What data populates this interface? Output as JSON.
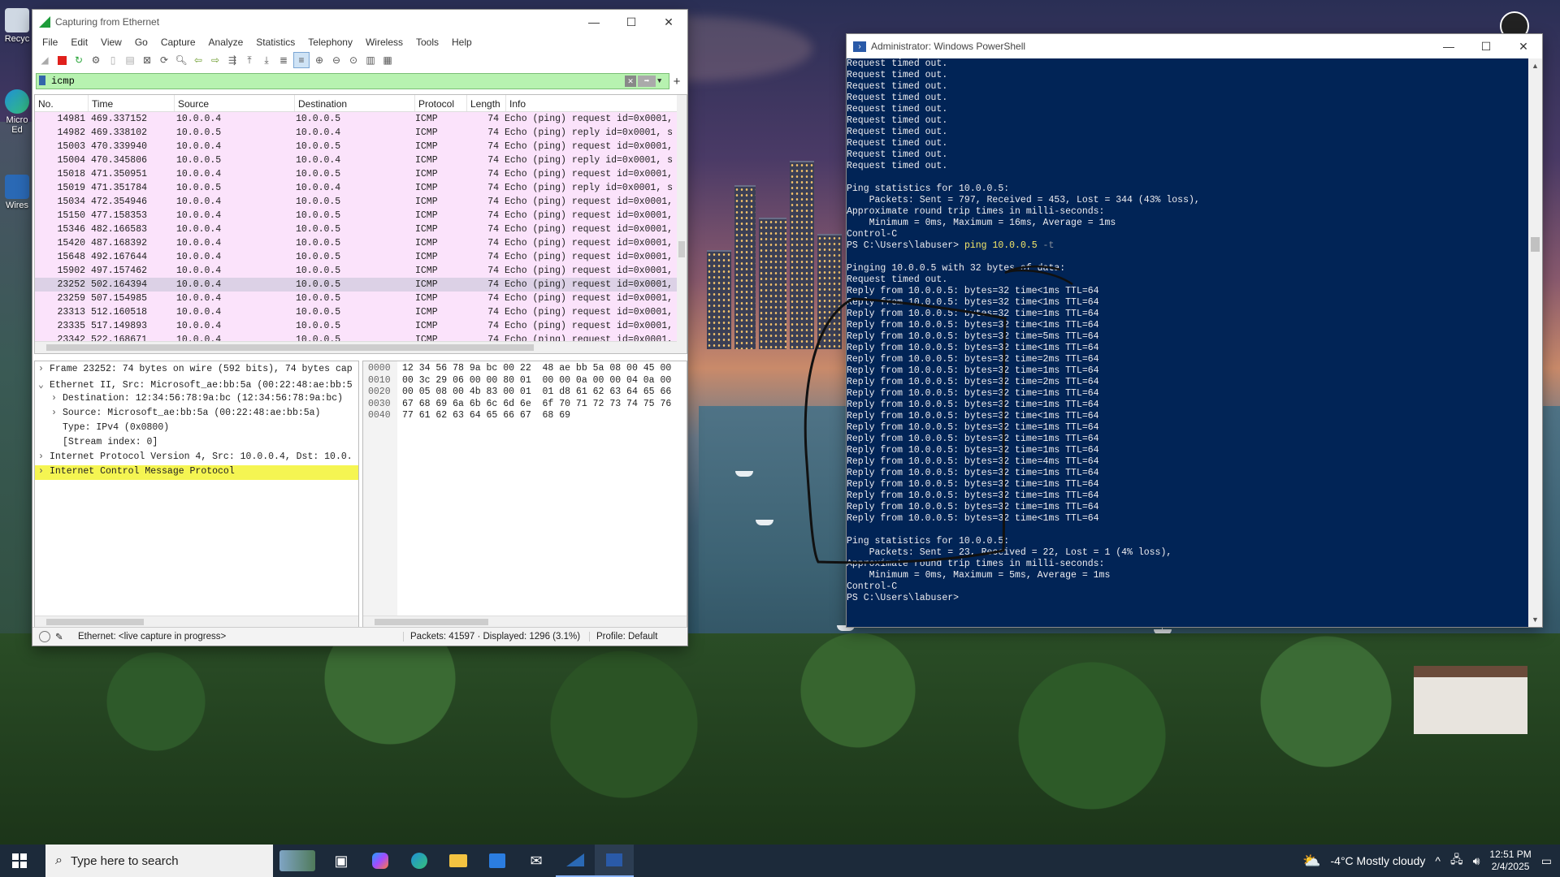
{
  "desktop": {
    "icons": [
      {
        "label": "Recyc"
      },
      {
        "label": "Micro Ed"
      },
      {
        "label": "Wires"
      }
    ]
  },
  "wireshark": {
    "title": "Capturing from Ethernet",
    "menu": [
      "File",
      "Edit",
      "View",
      "Go",
      "Capture",
      "Analyze",
      "Statistics",
      "Telephony",
      "Wireless",
      "Tools",
      "Help"
    ],
    "filter": "icmp",
    "columns": [
      "No.",
      "Time",
      "Source",
      "Destination",
      "Protocol",
      "Length",
      "Info"
    ],
    "packets": [
      {
        "no": "14981",
        "time": "469.337152",
        "src": "10.0.0.4",
        "dst": "10.0.0.5",
        "proto": "ICMP",
        "len": "74",
        "info": "Echo (ping) request  id=0x0001, s"
      },
      {
        "no": "14982",
        "time": "469.338102",
        "src": "10.0.0.5",
        "dst": "10.0.0.4",
        "proto": "ICMP",
        "len": "74",
        "info": "Echo (ping) reply    id=0x0001, s"
      },
      {
        "no": "15003",
        "time": "470.339940",
        "src": "10.0.0.4",
        "dst": "10.0.0.5",
        "proto": "ICMP",
        "len": "74",
        "info": "Echo (ping) request  id=0x0001, s"
      },
      {
        "no": "15004",
        "time": "470.345806",
        "src": "10.0.0.5",
        "dst": "10.0.0.4",
        "proto": "ICMP",
        "len": "74",
        "info": "Echo (ping) reply    id=0x0001, s"
      },
      {
        "no": "15018",
        "time": "471.350951",
        "src": "10.0.0.4",
        "dst": "10.0.0.5",
        "proto": "ICMP",
        "len": "74",
        "info": "Echo (ping) request  id=0x0001, s"
      },
      {
        "no": "15019",
        "time": "471.351784",
        "src": "10.0.0.5",
        "dst": "10.0.0.4",
        "proto": "ICMP",
        "len": "74",
        "info": "Echo (ping) reply    id=0x0001, s"
      },
      {
        "no": "15034",
        "time": "472.354946",
        "src": "10.0.0.4",
        "dst": "10.0.0.5",
        "proto": "ICMP",
        "len": "74",
        "info": "Echo (ping) request  id=0x0001, s"
      },
      {
        "no": "15150",
        "time": "477.158353",
        "src": "10.0.0.4",
        "dst": "10.0.0.5",
        "proto": "ICMP",
        "len": "74",
        "info": "Echo (ping) request  id=0x0001, s"
      },
      {
        "no": "15346",
        "time": "482.166583",
        "src": "10.0.0.4",
        "dst": "10.0.0.5",
        "proto": "ICMP",
        "len": "74",
        "info": "Echo (ping) request  id=0x0001, s"
      },
      {
        "no": "15420",
        "time": "487.168392",
        "src": "10.0.0.4",
        "dst": "10.0.0.5",
        "proto": "ICMP",
        "len": "74",
        "info": "Echo (ping) request  id=0x0001, s"
      },
      {
        "no": "15648",
        "time": "492.167644",
        "src": "10.0.0.4",
        "dst": "10.0.0.5",
        "proto": "ICMP",
        "len": "74",
        "info": "Echo (ping) request  id=0x0001, s"
      },
      {
        "no": "15902",
        "time": "497.157462",
        "src": "10.0.0.4",
        "dst": "10.0.0.5",
        "proto": "ICMP",
        "len": "74",
        "info": "Echo (ping) request  id=0x0001, s"
      },
      {
        "no": "23252",
        "time": "502.164394",
        "src": "10.0.0.4",
        "dst": "10.0.0.5",
        "proto": "ICMP",
        "len": "74",
        "info": "Echo (ping) request  id=0x0001, s",
        "selected": true
      },
      {
        "no": "23259",
        "time": "507.154985",
        "src": "10.0.0.4",
        "dst": "10.0.0.5",
        "proto": "ICMP",
        "len": "74",
        "info": "Echo (ping) request  id=0x0001, s"
      },
      {
        "no": "23313",
        "time": "512.160518",
        "src": "10.0.0.4",
        "dst": "10.0.0.5",
        "proto": "ICMP",
        "len": "74",
        "info": "Echo (ping) request  id=0x0001, s"
      },
      {
        "no": "23335",
        "time": "517.149893",
        "src": "10.0.0.4",
        "dst": "10.0.0.5",
        "proto": "ICMP",
        "len": "74",
        "info": "Echo (ping) request  id=0x0001, s"
      },
      {
        "no": "23342",
        "time": "522.168671",
        "src": "10.0.0.4",
        "dst": "10.0.0.5",
        "proto": "ICMP",
        "len": "74",
        "info": "Echo (ping) request  id=0x0001, s"
      }
    ],
    "details": [
      {
        "arrow": ">",
        "text": "Frame 23252: 74 bytes on wire (592 bits), 74 bytes cap",
        "indent": 0
      },
      {
        "arrow": "v",
        "text": "Ethernet II, Src: Microsoft_ae:bb:5a (00:22:48:ae:bb:5",
        "indent": 0
      },
      {
        "arrow": ">",
        "text": "Destination: 12:34:56:78:9a:bc (12:34:56:78:9a:bc)",
        "indent": 1
      },
      {
        "arrow": ">",
        "text": "Source: Microsoft_ae:bb:5a (00:22:48:ae:bb:5a)",
        "indent": 1
      },
      {
        "arrow": "",
        "text": "Type: IPv4 (0x0800)",
        "indent": 1
      },
      {
        "arrow": "",
        "text": "[Stream index: 0]",
        "indent": 1
      },
      {
        "arrow": ">",
        "text": "Internet Protocol Version 4, Src: 10.0.0.4, Dst: 10.0.",
        "indent": 0
      },
      {
        "arrow": ">",
        "text": "Internet Control Message Protocol",
        "indent": 0,
        "highlight": true
      }
    ],
    "bytes": [
      {
        "off": "0000",
        "hex": "12 34 56 78 9a bc 00 22  48 ae bb 5a 08 00 45 00"
      },
      {
        "off": "0010",
        "hex": "00 3c 29 06 00 00 80 01  00 00 0a 00 00 04 0a 00"
      },
      {
        "off": "0020",
        "hex": "00 05 08 00 4b 83 00 01  01 d8 61 62 63 64 65 66"
      },
      {
        "off": "0030",
        "hex": "67 68 69 6a 6b 6c 6d 6e  6f 70 71 72 73 74 75 76"
      },
      {
        "off": "0040",
        "hex": "77 61 62 63 64 65 66 67  68 69"
      }
    ],
    "status": {
      "interface": "Ethernet: <live capture in progress>",
      "packets": "Packets: 41597 · Displayed: 1296 (3.1%)",
      "profile": "Profile: Default"
    }
  },
  "powershell": {
    "title": "Administrator: Windows PowerShell",
    "lines": [
      "Request timed out.",
      "Request timed out.",
      "Request timed out.",
      "Request timed out.",
      "Request timed out.",
      "Request timed out.",
      "Request timed out.",
      "Request timed out.",
      "Request timed out.",
      "Request timed out.",
      "",
      "Ping statistics for 10.0.0.5:",
      "    Packets: Sent = 797, Received = 453, Lost = 344 (43% loss),",
      "Approximate round trip times in milli-seconds:",
      "    Minimum = 0ms, Maximum = 16ms, Average = 1ms",
      "Control-C",
      "PS C:\\Users\\labuser> ping 10.0.0.5 -t",
      "",
      "Pinging 10.0.0.5 with 32 bytes of data:",
      "Request timed out.",
      "Reply from 10.0.0.5: bytes=32 time<1ms TTL=64",
      "Reply from 10.0.0.5: bytes=32 time<1ms TTL=64",
      "Reply from 10.0.0.5: bytes=32 time=1ms TTL=64",
      "Reply from 10.0.0.5: bytes=32 time<1ms TTL=64",
      "Reply from 10.0.0.5: bytes=32 time=5ms TTL=64",
      "Reply from 10.0.0.5: bytes=32 time<1ms TTL=64",
      "Reply from 10.0.0.5: bytes=32 time=2ms TTL=64",
      "Reply from 10.0.0.5: bytes=32 time=1ms TTL=64",
      "Reply from 10.0.0.5: bytes=32 time=2ms TTL=64",
      "Reply from 10.0.0.5: bytes=32 time=1ms TTL=64",
      "Reply from 10.0.0.5: bytes=32 time=1ms TTL=64",
      "Reply from 10.0.0.5: bytes=32 time<1ms TTL=64",
      "Reply from 10.0.0.5: bytes=32 time=1ms TTL=64",
      "Reply from 10.0.0.5: bytes=32 time=1ms TTL=64",
      "Reply from 10.0.0.5: bytes=32 time=1ms TTL=64",
      "Reply from 10.0.0.5: bytes=32 time=4ms TTL=64",
      "Reply from 10.0.0.5: bytes=32 time=1ms TTL=64",
      "Reply from 10.0.0.5: bytes=32 time=1ms TTL=64",
      "Reply from 10.0.0.5: bytes=32 time=1ms TTL=64",
      "Reply from 10.0.0.5: bytes=32 time=1ms TTL=64",
      "Reply from 10.0.0.5: bytes=32 time<1ms TTL=64",
      "",
      "Ping statistics for 10.0.0.5:",
      "    Packets: Sent = 23, Received = 22, Lost = 1 (4% loss),",
      "Approximate round trip times in milli-seconds:",
      "    Minimum = 0ms, Maximum = 5ms, Average = 1ms",
      "Control-C",
      "PS C:\\Users\\labuser>"
    ]
  },
  "taskbar": {
    "search_placeholder": "Type here to search",
    "weather": "-4°C  Mostly cloudy",
    "time": "12:51 PM",
    "date": "2/4/2025"
  }
}
